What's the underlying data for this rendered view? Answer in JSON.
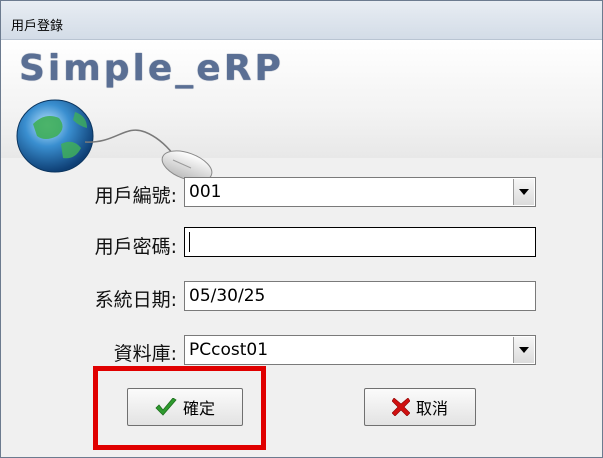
{
  "window": {
    "title": "用戶登錄"
  },
  "banner": {
    "brand_text": "Simple_eRP"
  },
  "form": {
    "user_id": {
      "label": "用戶編號:",
      "value": "001"
    },
    "password": {
      "label": "用戶密碼:",
      "value": ""
    },
    "system_date": {
      "label": "系統日期:",
      "value": "05/30/25"
    },
    "database": {
      "label": "資料庫:",
      "value": "PCcost01"
    }
  },
  "buttons": {
    "ok_label": "確定",
    "cancel_label": "取消"
  },
  "colors": {
    "highlight": "#e00000",
    "ok_check": "#2e9a2e",
    "cancel_x": "#d01010",
    "brand": "#5a6f94"
  },
  "icons": {
    "ok": "check-icon",
    "cancel": "x-icon",
    "dropdown": "chevron-down-icon"
  }
}
